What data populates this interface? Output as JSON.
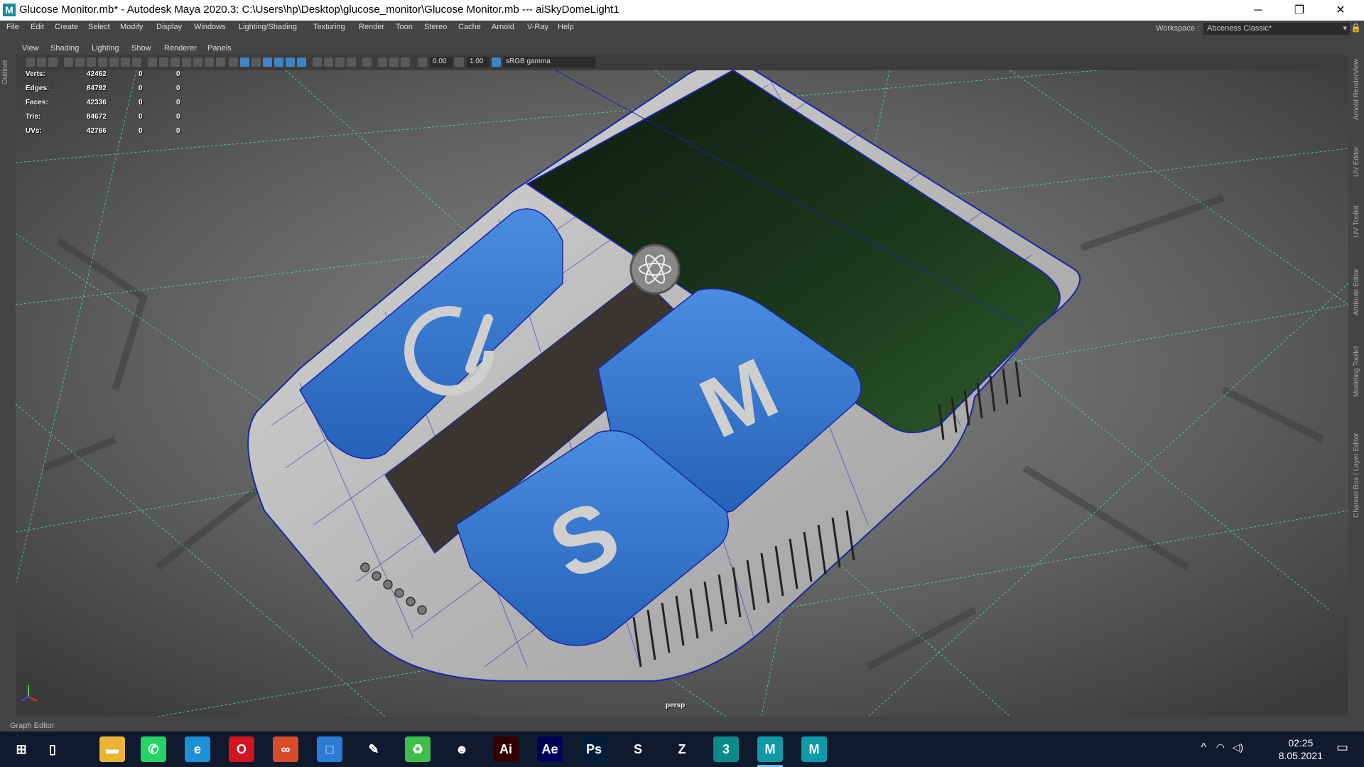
{
  "titlebar": {
    "title": "Glucose Monitor.mb* - Autodesk Maya 2020.3: C:\\Users\\hp\\Desktop\\glucose_monitor\\Glucose Monitor.mb   ---   aiSkyDomeLight1",
    "app_glyph": "M"
  },
  "menu": [
    "File",
    "Edit",
    "Create",
    "Select",
    "Modify",
    "Display",
    "Windows",
    "Lighting/Shading",
    "Texturing",
    "Render",
    "Toon",
    "Stereo",
    "Cache",
    "Arnold",
    "V-Ray",
    "Help"
  ],
  "workspace": {
    "label": "Workspace :",
    "value": "Abceness Classic*"
  },
  "left_strip": {
    "label": "Outliner"
  },
  "right_strip": [
    "Arnold RenderView",
    "UV Editor",
    "UV Toolkit",
    "Attribute Editor",
    "Modeling Toolkit",
    "Channel Box / Layer Editor"
  ],
  "panel_menu": [
    "View",
    "Shading",
    "Lighting",
    "Show",
    "Renderer",
    "Panels"
  ],
  "toolbar": {
    "exposure": "0.00",
    "gamma": "1.00",
    "colorspace": "sRGB gamma"
  },
  "hud": [
    {
      "label": "Verts:",
      "v1": "42462",
      "v2": "0",
      "v3": "0"
    },
    {
      "label": "Edges:",
      "v1": "84792",
      "v2": "0",
      "v3": "0"
    },
    {
      "label": "Faces:",
      "v1": "42336",
      "v2": "0",
      "v3": "0"
    },
    {
      "label": "Tris:",
      "v1": "84672",
      "v2": "0",
      "v3": "0"
    },
    {
      "label": "UVs:",
      "v1": "42766",
      "v2": "0",
      "v3": "0"
    }
  ],
  "camera": "persp",
  "graph_editor": "Graph Editor",
  "model_labels": {
    "button_m": "M",
    "button_s": "S"
  },
  "taskbar": {
    "apps": [
      {
        "name": "windows-start",
        "glyph": "⊞",
        "bg": "transparent"
      },
      {
        "name": "task-view",
        "glyph": "▯",
        "bg": "transparent"
      },
      {
        "name": "file-explorer",
        "glyph": "▬",
        "bg": "#e7b533"
      },
      {
        "name": "whatsapp",
        "glyph": "✆",
        "bg": "#25d366"
      },
      {
        "name": "edge",
        "glyph": "e",
        "bg": "#1b8fd8"
      },
      {
        "name": "opera",
        "glyph": "O",
        "bg": "#d3141e"
      },
      {
        "name": "app-swirl",
        "glyph": "∞",
        "bg": "#d84c2a"
      },
      {
        "name": "app-square",
        "glyph": "□",
        "bg": "#2c7bd6"
      },
      {
        "name": "app-pencil",
        "glyph": "✎",
        "bg": "transparent"
      },
      {
        "name": "app-green",
        "glyph": "♻",
        "bg": "#3cbf4a"
      },
      {
        "name": "app-character",
        "glyph": "☻",
        "bg": "transparent"
      },
      {
        "name": "illustrator",
        "glyph": "Ai",
        "bg": "#330000"
      },
      {
        "name": "after-effects",
        "glyph": "Ae",
        "bg": "#00005b"
      },
      {
        "name": "photoshop",
        "glyph": "Ps",
        "bg": "#001e36"
      },
      {
        "name": "app-s",
        "glyph": "S",
        "bg": "transparent"
      },
      {
        "name": "app-zbrush",
        "glyph": "Z",
        "bg": "transparent"
      },
      {
        "name": "3dsmax",
        "glyph": "3",
        "bg": "#0b8a8a"
      },
      {
        "name": "maya",
        "glyph": "M",
        "bg": "#0e9aa7"
      },
      {
        "name": "maya-2",
        "glyph": "M",
        "bg": "#0e9aa7"
      }
    ],
    "time": "02:25",
    "date": "8.05.2021"
  },
  "colors": {
    "button_blue": "#2f6fc8",
    "screen_green": "#1f3d1c",
    "wire": "#1c25a6",
    "grid": "#4de0b0"
  }
}
